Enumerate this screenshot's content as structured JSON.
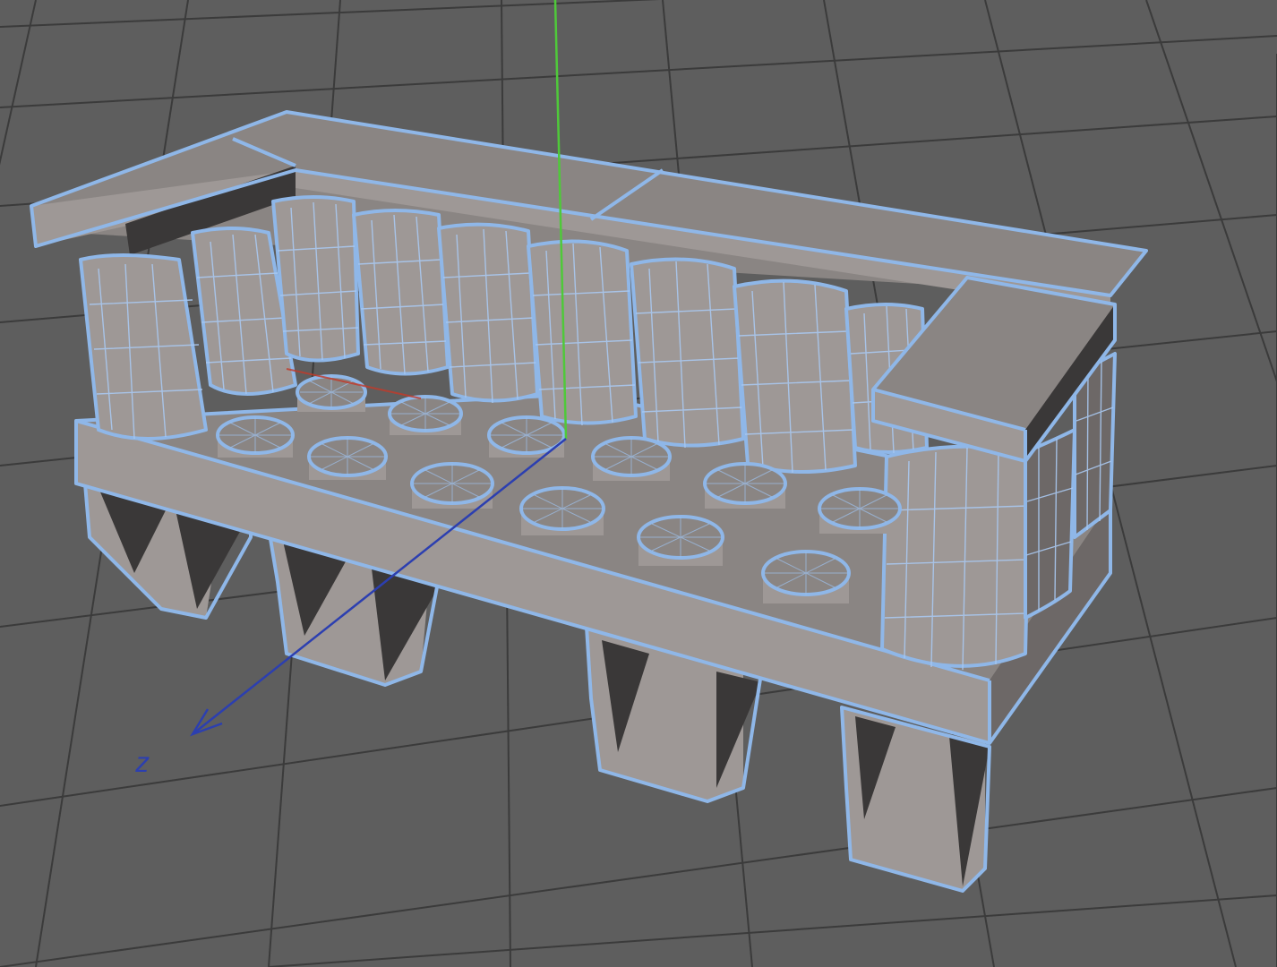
{
  "viewport": {
    "name": "3d-perspective-viewport",
    "background_color": "#5e5e5e",
    "grid_color": "#3b3b3b",
    "selection_wire_color": "#8fb7e8",
    "axis_colors": {
      "y": "#4fc93a",
      "z": "#2c3fb0",
      "x": "#c23a2a"
    },
    "axis_label_z": "z"
  }
}
